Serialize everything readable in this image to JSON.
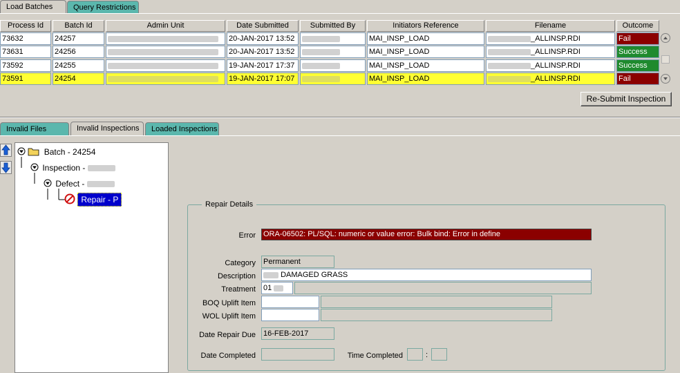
{
  "top_tabs": [
    "Load Batches",
    "Query Restrictions"
  ],
  "columns": [
    "Process Id",
    "Batch Id",
    "Admin Unit",
    "Date Submitted",
    "Submitted By",
    "Initiators Reference",
    "Filename",
    "Outcome"
  ],
  "rows": [
    {
      "process_id": "73632",
      "batch_id": "24257",
      "date": "20-JAN-2017 13:52",
      "ref": "MAI_INSP_LOAD",
      "filename": "_ALLINSP.RDI",
      "outcome": "Fail"
    },
    {
      "process_id": "73631",
      "batch_id": "24256",
      "date": "20-JAN-2017 13:52",
      "ref": "MAI_INSP_LOAD",
      "filename": "_ALLINSP.RDI",
      "outcome": "Success"
    },
    {
      "process_id": "73592",
      "batch_id": "24255",
      "date": "19-JAN-2017 17:37",
      "ref": "MAI_INSP_LOAD",
      "filename": "_ALLINSP.RDI",
      "outcome": "Success"
    },
    {
      "process_id": "73591",
      "batch_id": "24254",
      "date": "19-JAN-2017 17:07",
      "ref": "MAI_INSP_LOAD",
      "filename": "_ALLINSP.RDI",
      "outcome": "Fail"
    }
  ],
  "resubmit_label": "Re-Submit Inspection",
  "lower_tabs": [
    "Invalid Files",
    "Invalid Inspections",
    "Loaded Inspections"
  ],
  "tree": {
    "batch": "Batch - 24254",
    "inspection": "Inspection -",
    "defect": "Defect -",
    "repair": "Repair - P"
  },
  "repair_details": {
    "legend": "Repair Details",
    "error_label": "Error",
    "error_value": "ORA-06502: PL/SQL: numeric or value error: Bulk bind: Error in define",
    "category_label": "Category",
    "category_value": "Permanent",
    "description_label": "Description",
    "description_value": "DAMAGED GRASS",
    "treatment_label": "Treatment",
    "treatment_value": "01",
    "boq_label": "BOQ Uplift Item",
    "wol_label": "WOL Uplift Item",
    "date_due_label": "Date Repair Due",
    "date_due_value": "16-FEB-2017",
    "date_completed_label": "Date Completed",
    "time_completed_label": "Time Completed",
    "time_sep": ":"
  },
  "colors": {
    "teal": "#5bb7ad",
    "fail": "#8b0000",
    "success": "#1f8a2e",
    "selected_row": "#ffff33",
    "tree_selected": "#0000cc"
  }
}
